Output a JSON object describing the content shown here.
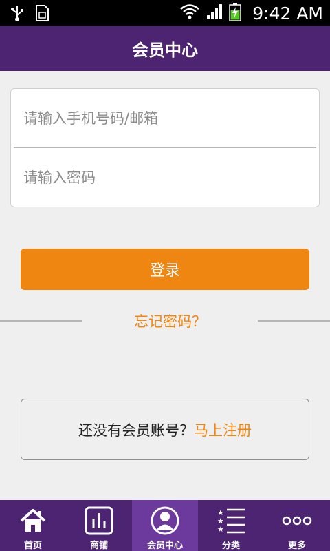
{
  "status_bar": {
    "time": "9:42 AM",
    "icons": [
      "usb-icon",
      "sim-card-icon",
      "wifi-icon",
      "signal-icon",
      "battery-charging-icon"
    ]
  },
  "header": {
    "title": "会员中心"
  },
  "form": {
    "account_placeholder": "请输入手机号码/邮箱",
    "password_placeholder": "请输入密码"
  },
  "login_button": {
    "label": "登录"
  },
  "forgot_password": {
    "label": "忘记密码？"
  },
  "register": {
    "question": "还没有会员账号？",
    "link": "马上注册"
  },
  "tabbar": {
    "items": [
      {
        "label": "首页",
        "icon": "home-icon"
      },
      {
        "label": "商铺",
        "icon": "shop-chart-icon"
      },
      {
        "label": "会员中心",
        "icon": "member-icon",
        "active": true
      },
      {
        "label": "分类",
        "icon": "category-list-icon"
      },
      {
        "label": "更多",
        "icon": "more-dots-icon"
      }
    ]
  },
  "colors": {
    "primary": "#4d2471",
    "active_tab": "#6c3a9c",
    "accent": "#f08612",
    "background": "#efefef"
  }
}
